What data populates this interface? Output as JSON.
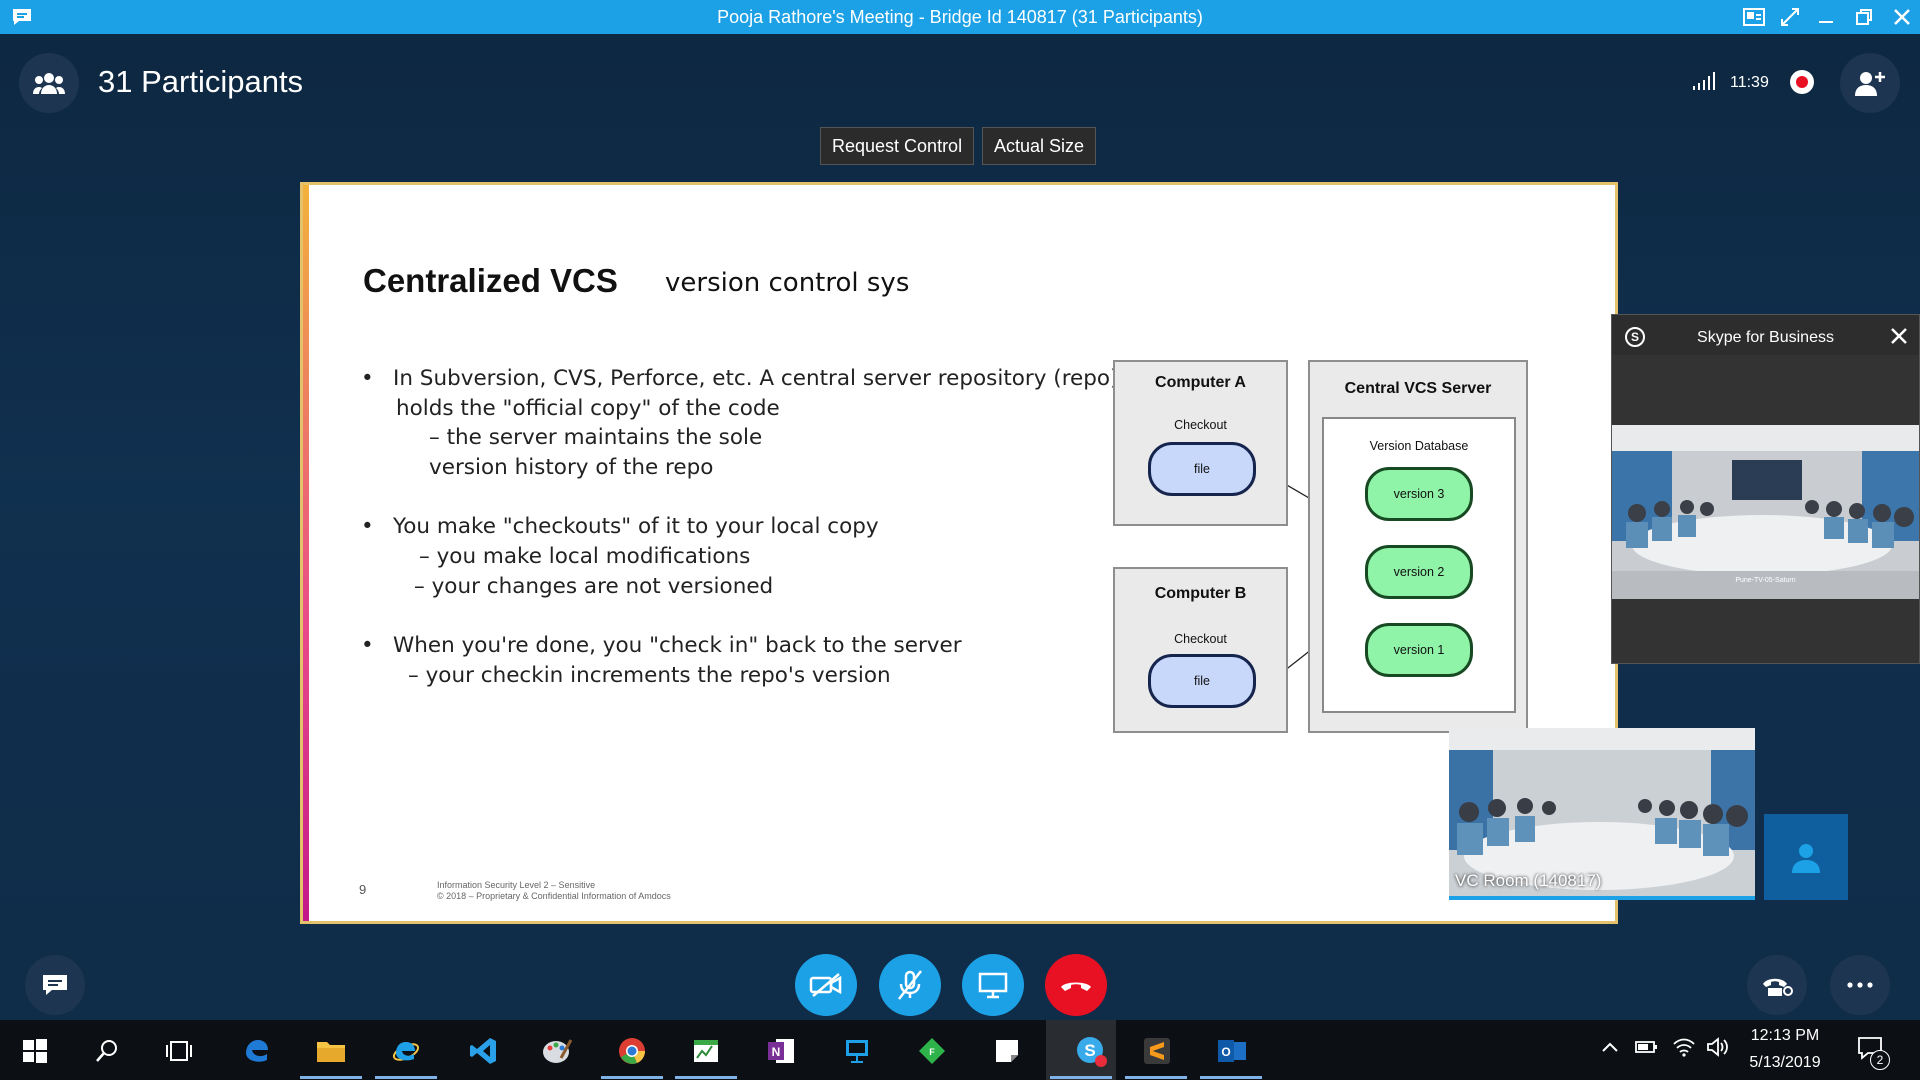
{
  "window": {
    "title": "Pooja Rathore's Meeting - Bridge Id 140817 (31 Participants)"
  },
  "header": {
    "participants_label": "31 Participants",
    "time": "11:39"
  },
  "controls": {
    "request_control": "Request Control",
    "actual_size": "Actual Size"
  },
  "slide": {
    "title": "Centralized VCS",
    "subtitle": "version control sys",
    "bullets": [
      {
        "lines": [
          "In Subversion, CVS, Perforce, etc. A central server repository (repo)",
          "holds the \"official copy\" of the code",
          "– the server maintains the sole",
          "version history of the repo"
        ]
      },
      {
        "lines": [
          "You make \"checkouts\" of it to your local copy",
          "– you make local modifications",
          "– your changes are not versioned"
        ]
      },
      {
        "lines": [
          "When you're done, you \"check in\" back to the server",
          "– your checkin increments the repo's version"
        ]
      }
    ],
    "diagram": {
      "computer_a": "Computer A",
      "computer_b": "Computer B",
      "checkout_label": "Checkout",
      "file_label": "file",
      "server_title": "Central VCS Server",
      "database_label": "Version Database",
      "versions": [
        "version 3",
        "version 2",
        "version 1"
      ]
    },
    "page_number": "9",
    "footer_line1": "Information Security Level 2 – Sensitive",
    "footer_line2": "© 2018 – Proprietary & Confidential Information of Amdocs"
  },
  "skype_popup": {
    "title": "Skype for Business",
    "video_caption": "Pune-TV-05-Saturn"
  },
  "self_video": {
    "label": "VC Room (140817)"
  },
  "taskbar": {
    "clock_time": "12:13 PM",
    "clock_date": "5/13/2019",
    "notification_count": "2"
  },
  "colors": {
    "title_bar": "#1da1e6",
    "call_button": "#1da1e6",
    "hangup_button": "#e81123",
    "version_fill": "#8ff3a8",
    "file_fill": "#c8d8fb"
  }
}
